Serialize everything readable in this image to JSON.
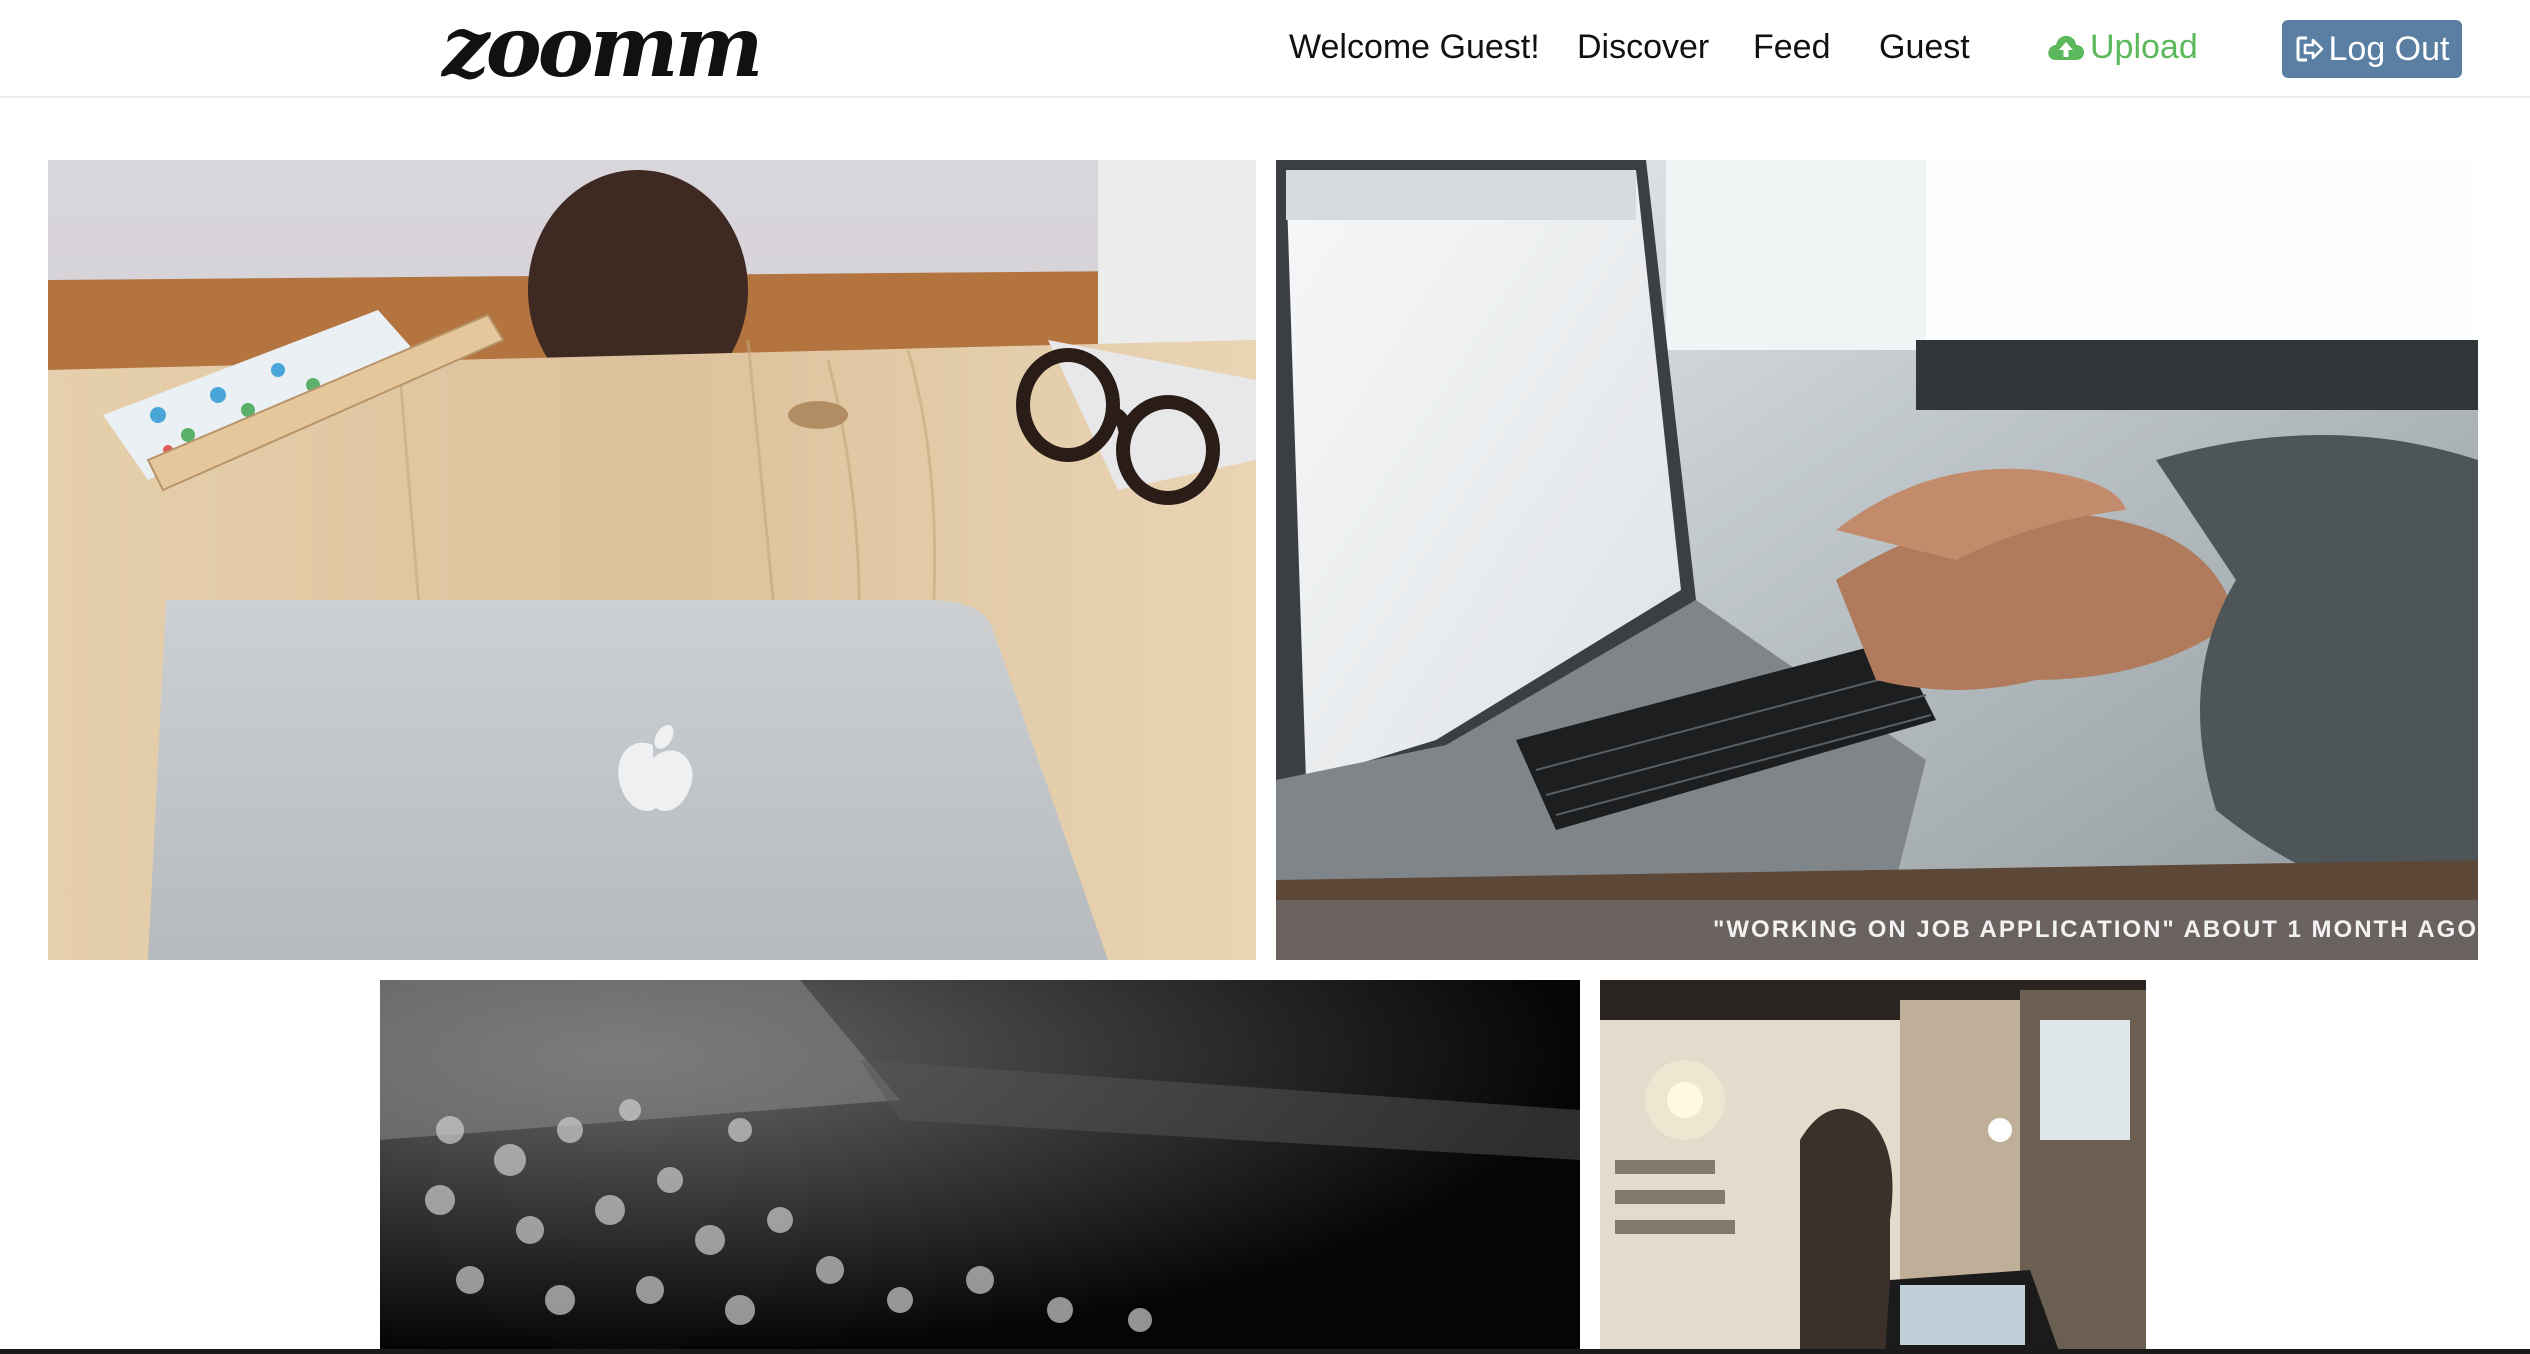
{
  "brand": {
    "logo_text": "zoomm"
  },
  "nav": {
    "welcome": "Welcome Guest!",
    "discover": "Discover",
    "feed": "Feed",
    "guest": "Guest",
    "upload": "Upload",
    "logout": "Log Out"
  },
  "colors": {
    "upload_green": "#5cb85c",
    "logout_blue": "#5b7fa3"
  },
  "icons": {
    "upload": "cloud-upload-icon",
    "logout": "sign-out-icon"
  },
  "gallery": {
    "photos": [
      {
        "caption": ""
      },
      {
        "caption": "\"WORKING ON JOB APPLICATION\" ABOUT 1 MONTH AGO"
      },
      {
        "caption": ""
      },
      {
        "caption": ""
      }
    ]
  }
}
